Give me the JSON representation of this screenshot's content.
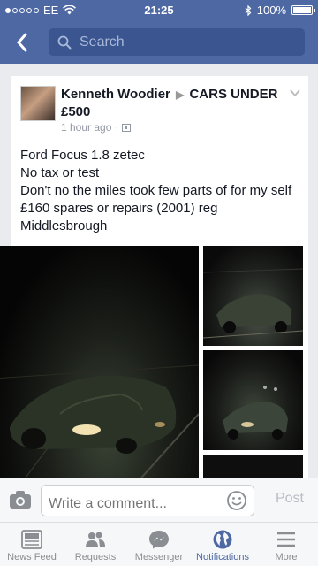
{
  "status_bar": {
    "carrier": "EE",
    "time": "21:25",
    "battery": "100%",
    "battery_level": 1.0
  },
  "search": {
    "placeholder": "Search"
  },
  "post": {
    "author": "Kenneth Woodier",
    "group": "CARS UNDER £500",
    "time": "1 hour ago",
    "lines": [
      "Ford Focus 1.8 zetec",
      "No tax or test",
      "Don't no the miles took few parts of for my self £160 spares or repairs (2001) reg",
      "Middlesbrough"
    ]
  },
  "comment_bar": {
    "placeholder": "Write a comment...",
    "post_label": "Post"
  },
  "tabs": [
    {
      "label": "News Feed",
      "icon": "news-feed-icon"
    },
    {
      "label": "Requests",
      "icon": "requests-icon"
    },
    {
      "label": "Messenger",
      "icon": "messenger-icon"
    },
    {
      "label": "Notifications",
      "icon": "globe-icon",
      "active": true
    },
    {
      "label": "More",
      "icon": "menu-icon"
    }
  ],
  "colors": {
    "brand_blue": "#4d68a3",
    "search_bg": "#3b5590",
    "inactive": "#8a8d91"
  }
}
